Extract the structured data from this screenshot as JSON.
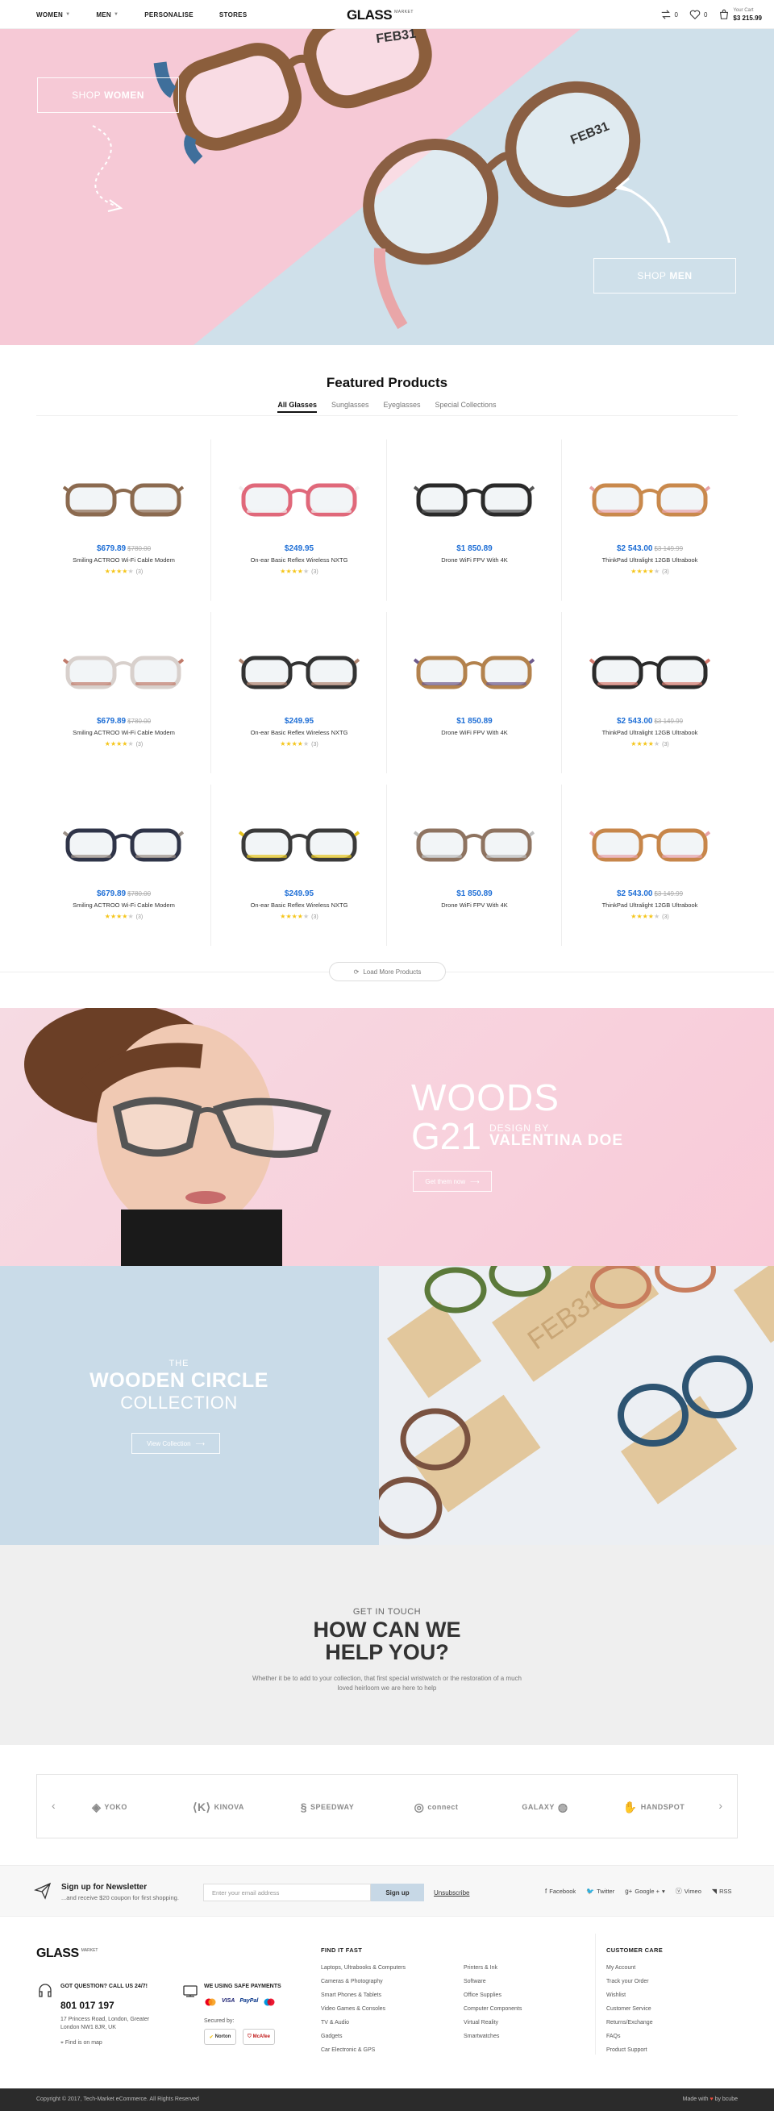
{
  "header": {
    "nav": [
      {
        "label": "WOMEN",
        "dropdown": true
      },
      {
        "label": "MEN",
        "dropdown": true
      },
      {
        "label": "PERSONALISE",
        "dropdown": false
      },
      {
        "label": "STORES",
        "dropdown": false
      }
    ],
    "logo_main": "GLASS",
    "logo_sub": "MARKET",
    "compare_count": "0",
    "wishlist_count": "0",
    "cart_label": "Your Cart",
    "cart_amount": "$3 215.99"
  },
  "hero": {
    "shop_women_prefix": "SHOP",
    "shop_women_bold": "WOMEN",
    "shop_men_prefix": "SHOP",
    "shop_men_bold": "MEN",
    "frame_text": "FEB31",
    "frame_sup": "st"
  },
  "featured": {
    "title": "Featured Products",
    "tabs": [
      "All Glasses",
      "Sunglasses",
      "Eyeglasses",
      "Special Collections"
    ],
    "active_tab": 0,
    "load_more": "Load More Products",
    "products": [
      {
        "price": "$679.89",
        "old": "$780.00",
        "name": "Smiling ACTROO Wi-Fi Cable Modem",
        "rating": 4,
        "reviews": "(3)",
        "frame": "#8b6a4f",
        "accent": "#8b6a4f"
      },
      {
        "price": "$249.95",
        "old": "",
        "name": "On-ear Basic Reflex Wireless NXTG",
        "rating": 4,
        "reviews": "(3)",
        "frame": "#e0687a",
        "accent": "#f1f1f1"
      },
      {
        "price": "$1 850.89",
        "old": "",
        "name": "Drone WiFi FPV With 4K",
        "rating": 0,
        "reviews": "",
        "frame": "#2a2a2a",
        "accent": "#555"
      },
      {
        "price": "$2 543.00",
        "old": "$3 149.99",
        "name": "ThinkPad Ultralight 12GB Ultrabook",
        "rating": 4,
        "reviews": "(3)",
        "frame": "#c9894c",
        "accent": "#e7a3a8"
      },
      {
        "price": "$679.89",
        "old": "$780.00",
        "name": "Smiling ACTROO Wi-Fi Cable Modem",
        "rating": 4,
        "reviews": "(3)",
        "frame": "#d8d0cc",
        "accent": "#c07a6a"
      },
      {
        "price": "$249.95",
        "old": "",
        "name": "On-ear Basic Reflex Wireless NXTG",
        "rating": 4,
        "reviews": "(3)",
        "frame": "#333",
        "accent": "#b08570"
      },
      {
        "price": "$1 850.89",
        "old": "",
        "name": "Drone WiFi FPV With 4K",
        "rating": 0,
        "reviews": "",
        "frame": "#b3824d",
        "accent": "#6d5a8c"
      },
      {
        "price": "$2 543.00",
        "old": "$3 149.99",
        "name": "ThinkPad Ultralight 12GB Ultrabook",
        "rating": 4,
        "reviews": "(3)",
        "frame": "#2b2b2b",
        "accent": "#d67a6e"
      },
      {
        "price": "$679.89",
        "old": "$780.00",
        "name": "Smiling ACTROO Wi-Fi Cable Modem",
        "rating": 4,
        "reviews": "(3)",
        "frame": "#2f3448",
        "accent": "#9a8f86"
      },
      {
        "price": "$249.95",
        "old": "",
        "name": "On-ear Basic Reflex Wireless NXTG",
        "rating": 4,
        "reviews": "(3)",
        "frame": "#3a3a3a",
        "accent": "#e6c420"
      },
      {
        "price": "$1 850.89",
        "old": "",
        "name": "Drone WiFi FPV With 4K",
        "rating": 0,
        "reviews": "",
        "frame": "#8e7360",
        "accent": "#bdbdbd"
      },
      {
        "price": "$2 543.00",
        "old": "$3 149.99",
        "name": "ThinkPad Ultralight 12GB Ultrabook",
        "rating": 4,
        "reviews": "(3)",
        "frame": "#c7864a",
        "accent": "#e7a3a8"
      }
    ]
  },
  "woods": {
    "line1": "WOODS",
    "line2": "G21",
    "design_by": "DESIGN BY",
    "designer": "VALENTINA DOE",
    "cta": "Get them now"
  },
  "circle": {
    "the": "THE",
    "title": "WOODEN CIRCLE",
    "sub": "COLLECTION",
    "cta": "View Collection"
  },
  "contact": {
    "kicker": "GET IN TOUCH",
    "line1": "HOW CAN WE",
    "line2": "HELP YOU?",
    "text": "Whether it be to add to your collection, that first special wristwatch or the restoration of a much loved heirloom we are here to help"
  },
  "brands": [
    "YOKO",
    "KINOVA",
    "SPEEDWAY",
    "connect",
    "GALAXY",
    "HANDSPOT"
  ],
  "newsletter": {
    "title": "Sign up for Newsletter",
    "sub": "...and receive $20 coupon for first shopping.",
    "placeholder": "Enter your email address",
    "button": "Sign up",
    "unsubscribe": "Unsubscribe",
    "socials": [
      "Facebook",
      "Twitter",
      "Google +",
      "Vimeo",
      "RSS"
    ]
  },
  "footer": {
    "logo_main": "GLASS",
    "logo_sub": "MARKET",
    "question_label": "GOT QUESTION? CALL US 24/7!",
    "phone": "801 017 197",
    "address": "17 Princess Road, London, Greater London NW1 8JR, UK",
    "map_link": "Find is on map",
    "payments_label": "WE USING SAFE PAYMENTS",
    "cards": [
      "VISA",
      "PayPal"
    ],
    "secured_label": "Secured by:",
    "secure_badges": [
      "Norton",
      "McAfee"
    ],
    "find_it_fast": "FIND IT FAST",
    "col1": [
      "Laptops, Ultrabooks & Computers",
      "Cameras & Photography",
      "Smart Phones & Tablets",
      "Video Games & Consoles",
      "TV & Audio",
      "Gadgets",
      "Car Electronic & GPS"
    ],
    "col2": [
      "Printers & Ink",
      "Software",
      "Office Supplies",
      "Computer Components",
      "Virtual Reality",
      "Smartwatches"
    ],
    "customer_care": "CUSTOMER CARE",
    "col3": [
      "My Account",
      "Track your Order",
      "Wishlist",
      "Customer Service",
      "Returns/Exchange",
      "FAQs",
      "Product Support"
    ],
    "copyright": "Copyright © 2017, Tech-Market eCommerce. All Rights Reserved",
    "made_with": "Made with",
    "made_by": "by bcube"
  },
  "colors": {
    "accent_blue": "#1f6fd6",
    "hero_pink": "#f6c9d6",
    "hero_blue": "#cfe0ea",
    "star": "#f5c518"
  }
}
